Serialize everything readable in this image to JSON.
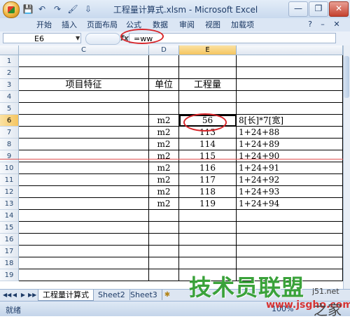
{
  "window": {
    "title": "工程量计算式.xlsm - Microsoft Excel",
    "minimize_label": "—",
    "restore_label": "❐",
    "close_label": "✕"
  },
  "quick_access": {
    "save": "💾",
    "undo": "↶",
    "redo": "↷",
    "fill": "🖌",
    "more": "⇩"
  },
  "ribbon": {
    "tabs": [
      "开始",
      "插入",
      "页面布局",
      "公式",
      "数据",
      "审阅",
      "视图",
      "加载项"
    ],
    "help_icon": "?",
    "restore_icon": "–",
    "close_icon": "✕"
  },
  "formula_bar": {
    "name_box": "E6",
    "fx_label": "fx",
    "formula": "=ww"
  },
  "columns": [
    "C",
    "D",
    "E"
  ],
  "active_column": "E",
  "rows": [
    {
      "n": "1",
      "C": "",
      "D": "",
      "E": "",
      "F": ""
    },
    {
      "n": "2",
      "C": "",
      "D": "",
      "E": "",
      "F": ""
    },
    {
      "n": "3",
      "C": "项目特征",
      "D": "单位",
      "E": "工程量",
      "F": ""
    },
    {
      "n": "4",
      "C": "",
      "D": "",
      "E": "",
      "F": ""
    },
    {
      "n": "5",
      "C": "",
      "D": "",
      "E": "",
      "F": ""
    },
    {
      "n": "6",
      "C": "",
      "D": "m2",
      "E": "56",
      "F": "8[长]*7[宽]"
    },
    {
      "n": "7",
      "C": "",
      "D": "m2",
      "E": "113",
      "F": "1+24+88"
    },
    {
      "n": "8",
      "C": "",
      "D": "m2",
      "E": "114",
      "F": "1+24+89"
    },
    {
      "n": "9",
      "C": "",
      "D": "m2",
      "E": "115",
      "F": "1+24+90"
    },
    {
      "n": "10",
      "C": "",
      "D": "m2",
      "E": "116",
      "F": "1+24+91"
    },
    {
      "n": "11",
      "C": "",
      "D": "m2",
      "E": "117",
      "F": "1+24+92"
    },
    {
      "n": "12",
      "C": "",
      "D": "m2",
      "E": "118",
      "F": "1+24+93"
    },
    {
      "n": "13",
      "C": "",
      "D": "m2",
      "E": "119",
      "F": "1+24+94"
    },
    {
      "n": "14",
      "C": "",
      "D": "",
      "E": "",
      "F": ""
    },
    {
      "n": "15",
      "C": "",
      "D": "",
      "E": "",
      "F": ""
    },
    {
      "n": "16",
      "C": "",
      "D": "",
      "E": "",
      "F": ""
    },
    {
      "n": "17",
      "C": "",
      "D": "",
      "E": "",
      "F": ""
    },
    {
      "n": "18",
      "C": "",
      "D": "",
      "E": "",
      "F": ""
    },
    {
      "n": "19",
      "C": "",
      "D": "",
      "E": "",
      "F": ""
    }
  ],
  "active_row": "6",
  "sheet_tabs": {
    "nav": [
      "◀◀",
      "◀",
      "▶",
      "▶▶"
    ],
    "tabs": [
      "工程量计算式",
      "Sheet2",
      "Sheet3"
    ],
    "new_sheet_icon": "✱"
  },
  "status": {
    "ready": "就绪",
    "zoom": "100%"
  },
  "watermark": {
    "logo": "技术员联盟",
    "url": "www.jsgho.com",
    "site": "j51.net",
    "home": "之家"
  }
}
